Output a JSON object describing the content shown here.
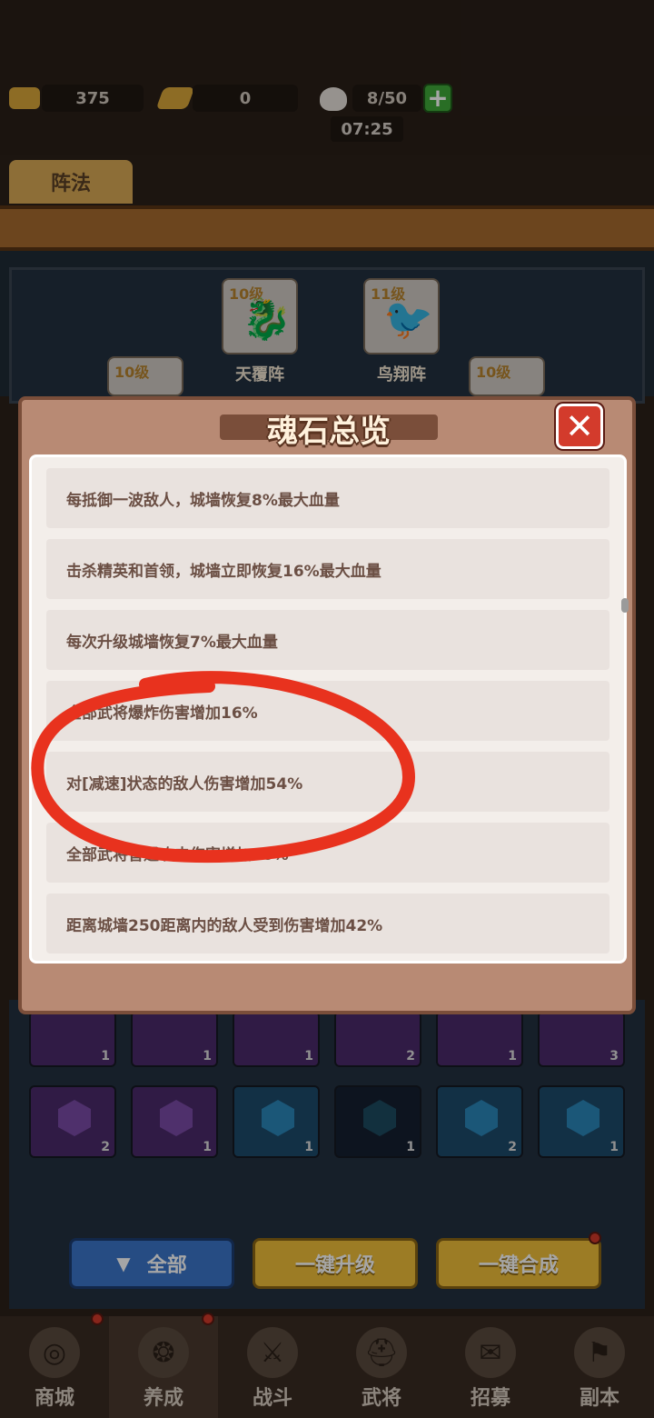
{
  "resources": {
    "gold": "375",
    "tickets": "0",
    "stamina": "8/50",
    "timer": "07:25"
  },
  "tab": "阵法",
  "formations": [
    {
      "level": "10级",
      "name": "天覆阵"
    },
    {
      "level": "11级",
      "name": "鸟翔阵"
    },
    {
      "level": "10级",
      "name": ""
    },
    {
      "level": "10级",
      "name": ""
    }
  ],
  "modal": {
    "title": "魂石总览",
    "items": [
      "每抵御一波敌人，城墙恢复8%最大血量",
      "击杀精英和首领，城墙立即恢复16%最大血量",
      "每次升级城墙恢复7%最大血量",
      "全部武将爆炸伤害增加16%",
      "对[减速]状态的敌人伤害增加54%",
      "全部武将普通攻击伤害增加30%",
      "距离城墙250距离内的敌人受到伤害增加42%"
    ]
  },
  "grid_counts_row1": [
    "1",
    "1",
    "1",
    "2",
    "1",
    "3"
  ],
  "grid_counts_row2": [
    "2",
    "1",
    "1",
    "1",
    "2",
    "1"
  ],
  "buttons": {
    "all": "全部",
    "upgrade_all": "一键升级",
    "merge_all": "一键合成"
  },
  "nav": [
    "商城",
    "养成",
    "战斗",
    "武将",
    "招募",
    "副本"
  ],
  "colors": {
    "modal_bg": "#b88a74",
    "close_red": "#d33b2c",
    "annotation_red": "#e8321e"
  }
}
